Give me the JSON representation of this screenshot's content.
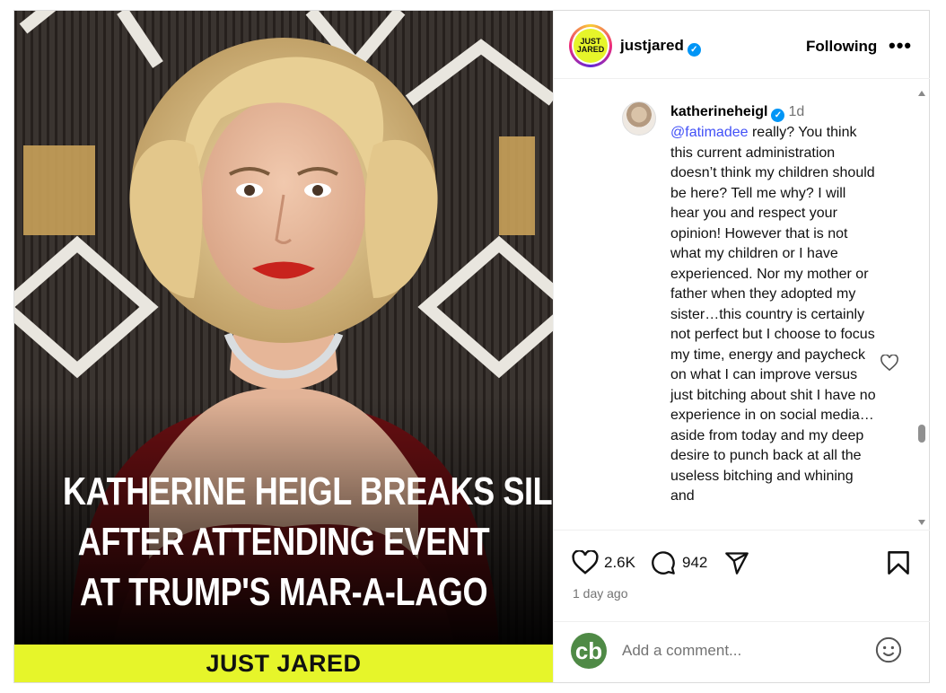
{
  "post": {
    "image": {
      "headline_lines": [
        "KATHERINE HEIGL BREAKS SILENCE",
        "AFTER ATTENDING EVENT",
        "AT TRUMP'S MAR-A-LAGO"
      ],
      "brand": "JUST JARED",
      "brand_color": "#e6f52a"
    },
    "header": {
      "username": "justjared",
      "avatar_text_top": "JUST",
      "avatar_text_bottom": "JARED",
      "follow_label": "Following",
      "more_label": "•••"
    },
    "comment": {
      "username": "katherineheigl",
      "time": "1d",
      "mention": "@fatimadee",
      "text": " really? You think this current administration doesn’t think my children should be here? Tell me why? I will hear you and respect your opinion! However that is not what my children or I have experienced. Nor my mother or father when they adopted my sister…this country is certainly not perfect but I choose to focus my time, energy and paycheck on what I can improve versus just bitching about shit I have no experience in on social media…aside from today and my deep desire to punch back at all the useless bitching and whining and"
    },
    "actions": {
      "likes": "2.6K",
      "comments": "942",
      "date": "1 day ago"
    },
    "add_comment": {
      "placeholder": "Add a comment...",
      "avatar_letters": "cb"
    }
  },
  "icons": [
    "verified-icon",
    "more-icon",
    "heart-icon",
    "comment-icon",
    "share-icon",
    "bookmark-icon",
    "emoji-icon"
  ]
}
